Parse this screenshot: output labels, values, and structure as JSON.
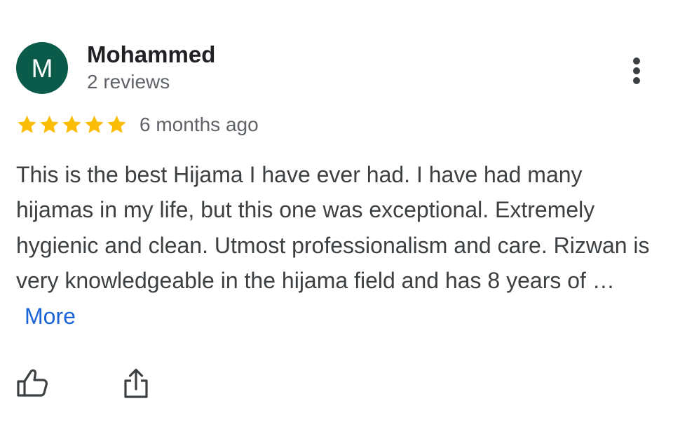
{
  "reviewer": {
    "initial": "M",
    "name": "Mohammed",
    "review_count": "2 reviews",
    "avatar_color": "#0b5b4b"
  },
  "review": {
    "rating": 5,
    "rating_max": 5,
    "star_color": "#fbbc04",
    "time": "6 months ago",
    "text": "This is the best Hijama I have ever had. I have had many hijamas in my life, but this one was exceptional. Extremely hygienic and clean. Utmost professionalism and care. Rizwan is very knowledgeable in the hijama field and has 8 years of …",
    "more_label": "More",
    "link_color": "#1a64d8"
  },
  "actions": {
    "more_options_icon": "more-vert-icon",
    "like_icon": "thumb-up-icon",
    "share_icon": "share-icon"
  }
}
